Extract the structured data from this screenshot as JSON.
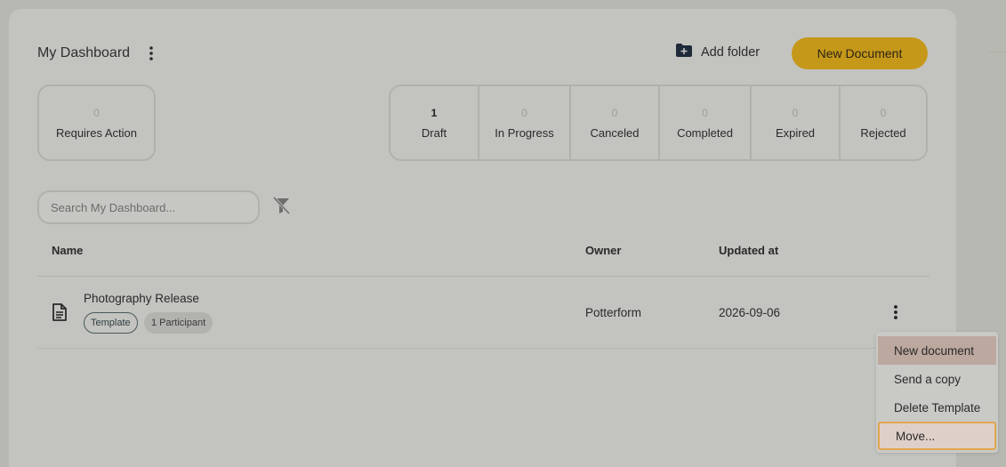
{
  "header": {
    "title": "My Dashboard",
    "add_folder_label": "Add folder",
    "new_document_label": "New Document"
  },
  "stats": {
    "requires_action": {
      "count": "0",
      "label": "Requires Action"
    },
    "items": [
      {
        "count": "1",
        "label": "Draft"
      },
      {
        "count": "0",
        "label": "In Progress"
      },
      {
        "count": "0",
        "label": "Canceled"
      },
      {
        "count": "0",
        "label": "Completed"
      },
      {
        "count": "0",
        "label": "Expired"
      },
      {
        "count": "0",
        "label": "Rejected"
      }
    ]
  },
  "search": {
    "placeholder": "Search My Dashboard..."
  },
  "table": {
    "columns": [
      "Name",
      "Owner",
      "Updated at"
    ],
    "rows": [
      {
        "name": "Photography Release",
        "tags": [
          "Template",
          "1 Participant"
        ],
        "owner": "Potterform",
        "updated": "2026-09-06"
      }
    ]
  },
  "context_menu": {
    "items": [
      "New document",
      "Send a copy",
      "Delete Template",
      "Move..."
    ]
  },
  "colors": {
    "accent": "#c6981a",
    "overlay_bg": "#b8b8b2",
    "focus_outline": "#e0a64e"
  }
}
